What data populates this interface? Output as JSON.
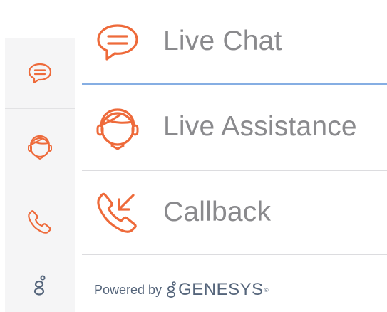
{
  "colors": {
    "icon_orange": "#ee6a3a",
    "label_gray": "#8a8a8d",
    "active_underline": "#86aee3",
    "brand_text": "#55657b"
  },
  "rail": {
    "items": [
      {
        "icon": "chat-bubble-icon"
      },
      {
        "icon": "agent-headset-icon"
      },
      {
        "icon": "phone-icon"
      },
      {
        "icon": "genesys-logo-icon"
      }
    ]
  },
  "menu": {
    "items": [
      {
        "label": "Live Chat",
        "icon": "chat-bubble-icon",
        "active": true
      },
      {
        "label": "Live Assistance",
        "icon": "agent-headset-icon"
      },
      {
        "label": "Callback",
        "icon": "callback-phone-icon"
      }
    ],
    "powered_by": "Powered by",
    "brand": "GENESYS"
  }
}
